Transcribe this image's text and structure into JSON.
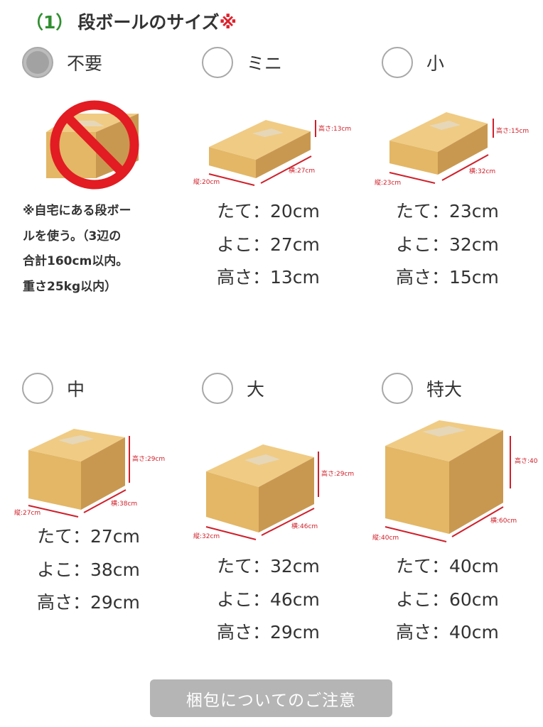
{
  "section": {
    "number": "（1）",
    "title": "段ボールのサイズ",
    "required_mark": "※"
  },
  "options": [
    {
      "label": "不要",
      "selected": true
    },
    {
      "label": "ミニ",
      "selected": false,
      "dims_labels": {
        "tate": "縦:20cm",
        "yoko": "横:27cm",
        "taka": "高さ:13cm"
      },
      "dims": [
        "たて：20cm",
        "よこ：27cm",
        "高さ：13cm"
      ]
    },
    {
      "label": "小",
      "selected": false,
      "dims_labels": {
        "tate": "縦:23cm",
        "yoko": "横:32cm",
        "taka": "高さ:15cm"
      },
      "dims": [
        "たて：23cm",
        "よこ：32cm",
        "高さ：15cm"
      ]
    },
    {
      "label": "中",
      "selected": false,
      "dims_labels": {
        "tate": "縦:27cm",
        "yoko": "横:38cm",
        "taka": "高さ:29cm"
      },
      "dims": [
        "たて：27cm",
        "よこ：38cm",
        "高さ：29cm"
      ]
    },
    {
      "label": "大",
      "selected": false,
      "dims_labels": {
        "tate": "縦:32cm",
        "yoko": "横:46cm",
        "taka": "高さ:29cm"
      },
      "dims": [
        "たて：32cm",
        "よこ：46cm",
        "高さ：29cm"
      ]
    },
    {
      "label": "特大",
      "selected": false,
      "dims_labels": {
        "tate": "縦:40cm",
        "yoko": "横:60cm",
        "taka": "高さ:40"
      },
      "dims": [
        "たて：40cm",
        "よこ：60cm",
        "高さ：40cm"
      ]
    }
  ],
  "no_box_note": {
    "lines": [
      "※自宅にある段ボー",
      "ルを使う。（3辺の",
      "合計160cm以内。",
      "重さ25kg以内）"
    ]
  },
  "footer": {
    "button_label": "梱包についてのご注意"
  },
  "colors": {
    "accent_green": "#2f8f2f",
    "required_red": "#e0202a",
    "dimension_red": "#d0202a",
    "button_gray": "#b5b5b5",
    "radio_selected": "#a2a2a2",
    "box_front": "#e3b766",
    "box_top": "#f0cb84",
    "box_side": "#c99850",
    "tape": "#e6d7b8"
  },
  "icons": {
    "no_box": "prohibited-icon"
  }
}
